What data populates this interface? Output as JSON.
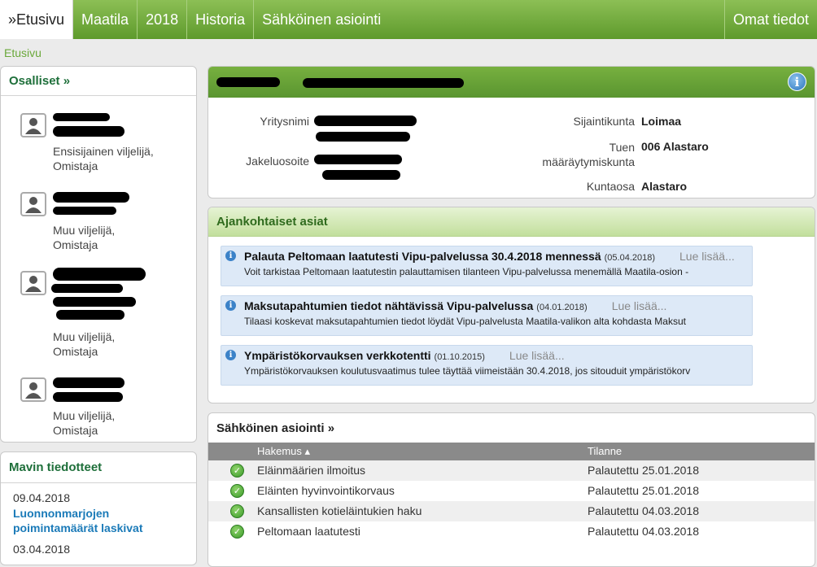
{
  "nav": {
    "tabs": [
      "»Etusivu",
      "Maatila",
      "2018",
      "Historia",
      "Sähköinen asiointi"
    ],
    "right": "Omat tiedot"
  },
  "breadcrumb": "Etusivu",
  "osalliset": {
    "title": "Osalliset »",
    "people": [
      {
        "role": "Ensisijainen viljelijä, Omistaja"
      },
      {
        "role": "Muu viljelijä, Omistaja"
      },
      {
        "role": "Muu viljelijä, Omistaja"
      },
      {
        "role": "Muu viljelijä, Omistaja"
      }
    ]
  },
  "mavi": {
    "title": "Mavin tiedotteet",
    "items": [
      {
        "date": "09.04.2018",
        "title": "Luonnonmarjojen poimintamäärät laskivat"
      },
      {
        "date": "03.04.2018",
        "title": ""
      }
    ]
  },
  "farm": {
    "labels": {
      "company": "Yritysnimi",
      "address": "Jakeluosoite",
      "municipality": "Sijaintikunta",
      "support_municipality": "Tuen määräytymiskunta",
      "district": "Kuntaosa"
    },
    "values": {
      "municipality": "Loimaa",
      "support_municipality": "006 Alastaro",
      "district": "Alastaro"
    }
  },
  "current": {
    "title": "Ajankohtaiset asiat",
    "more_label": "Lue lisää...",
    "items": [
      {
        "title": "Palauta Peltomaan laatutesti Vipu-palvelussa 30.4.2018 mennessä",
        "date": "(05.04.2018)",
        "body": "Voit tarkistaa Peltomaan laatutestin palauttamisen tilanteen Vipu-palvelussa menemällä Maatila-osion -"
      },
      {
        "title": "Maksutapahtumien tiedot nähtävissä Vipu-palvelussa",
        "date": "(04.01.2018)",
        "body": "Tilaasi koskevat maksutapahtumien tiedot löydät Vipu-palvelusta Maatila-valikon alta kohdasta Maksut"
      },
      {
        "title": "Ympäristökorvauksen verkkotentti",
        "date": "(01.10.2015)",
        "body": "Ympäristökorvauksen koulutusvaatimus tulee täyttää viimeistään 30.4.2018, jos sitouduit ympäristökorv"
      }
    ]
  },
  "eservice": {
    "title": "Sähköinen asiointi »",
    "columns": {
      "application": "Hakemus ▴",
      "status": "Tilanne"
    },
    "rows": [
      {
        "name": "Eläinmäärien ilmoitus",
        "status": "Palautettu 25.01.2018"
      },
      {
        "name": "Eläinten hyvinvointikorvaus",
        "status": "Palautettu 25.01.2018"
      },
      {
        "name": "Kansallisten kotieläintukien haku",
        "status": "Palautettu 04.03.2018"
      },
      {
        "name": "Peltomaan laatutesti",
        "status": "Palautettu 04.03.2018"
      }
    ]
  },
  "icons": {
    "info": "info-icon",
    "check": "check-icon",
    "user": "user-icon"
  }
}
